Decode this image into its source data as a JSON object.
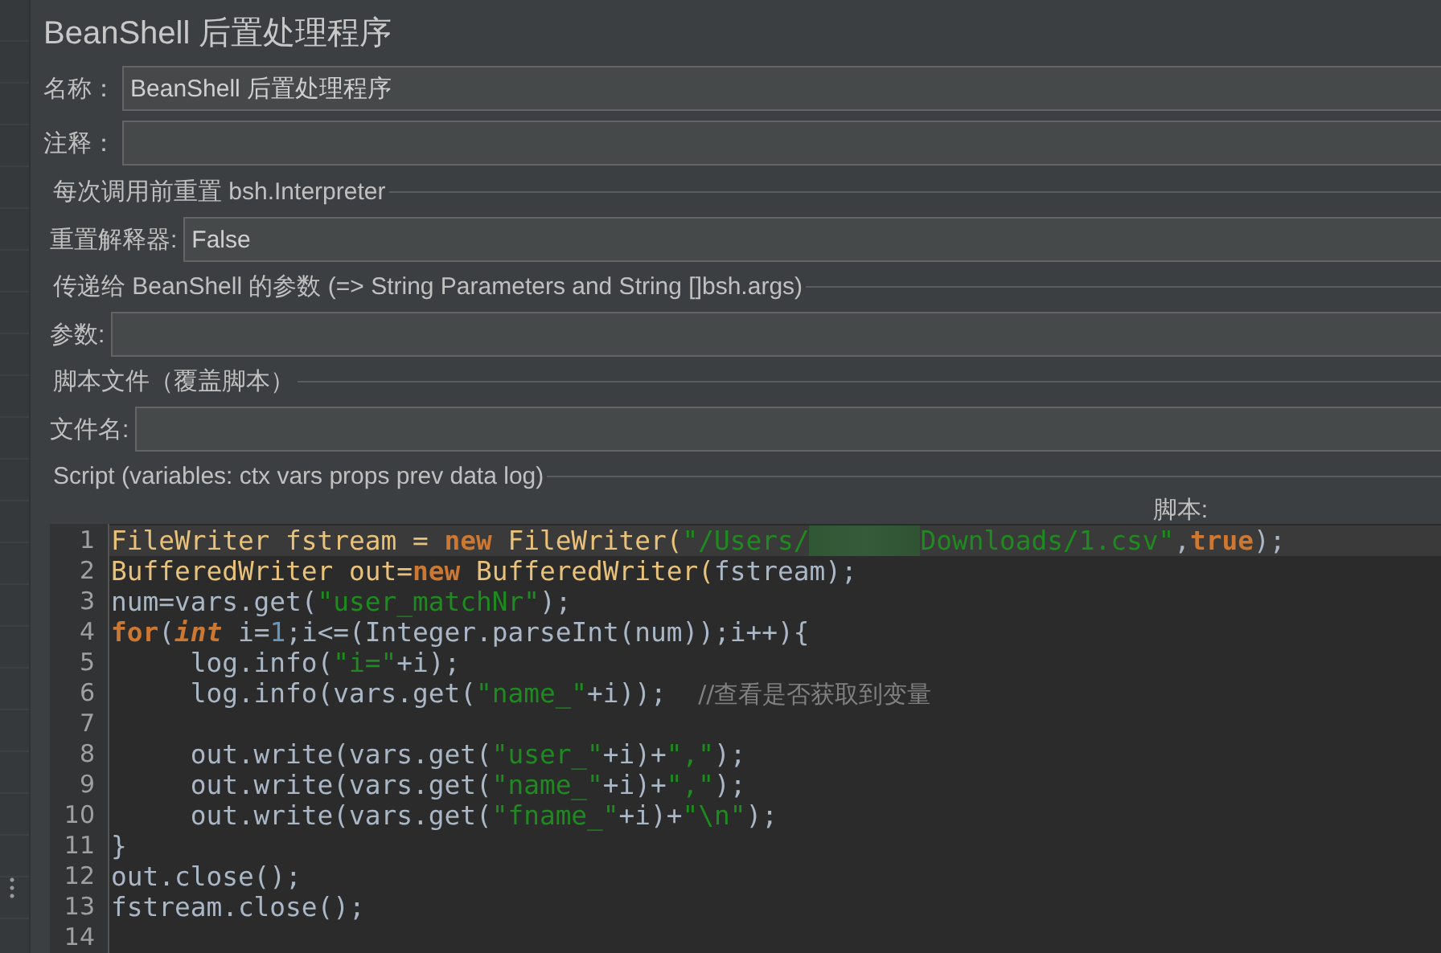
{
  "title": "BeanShell 后置处理程序",
  "fields": [
    {
      "label": "名称：",
      "value": "BeanShell 后置处理程序"
    },
    {
      "label": "注释："
    }
  ],
  "sections": [
    {
      "heading": "每次调用前重置 bsh.Interpreter",
      "field": {
        "label": "重置解释器:",
        "value": "False"
      }
    },
    {
      "heading": "传递给 BeanShell 的参数 (=> String Parameters and String []bsh.args)",
      "field": {
        "label": "参数:"
      }
    },
    {
      "heading": "脚本文件（覆盖脚本）",
      "field": {
        "label": "文件名:"
      }
    }
  ],
  "script": {
    "heading": "Script (variables: ctx vars props prev data log)",
    "editor_label": "脚本:",
    "lines": [
      {
        "number": "1",
        "current": true,
        "tokens": [
          {
            "kind": "class",
            "text": "FileWriter fstream = "
          },
          {
            "kind": "keyword",
            "text": "new"
          },
          {
            "kind": "class",
            "text": " FileWriter("
          },
          {
            "kind": "string",
            "text": "\"/Users/"
          },
          {
            "kind": "redacted"
          },
          {
            "kind": "string",
            "text": "Downloads/1.csv\""
          },
          {
            "kind": "plain",
            "text": ","
          },
          {
            "kind": "keyword",
            "text": "true"
          },
          {
            "kind": "plain",
            "text": ");"
          }
        ]
      },
      {
        "number": "2",
        "current": false,
        "tokens": [
          {
            "kind": "class",
            "text": "BufferedWriter out="
          },
          {
            "kind": "keyword",
            "text": "new"
          },
          {
            "kind": "class",
            "text": " BufferedWriter("
          },
          {
            "kind": "plain",
            "text": "fstream);"
          }
        ]
      },
      {
        "number": "3",
        "current": false,
        "tokens": [
          {
            "kind": "plain",
            "text": "num=vars.get("
          },
          {
            "kind": "string",
            "text": "\"user_matchNr\""
          },
          {
            "kind": "plain",
            "text": ");"
          }
        ]
      },
      {
        "number": "4",
        "current": false,
        "tokens": [
          {
            "kind": "keyword",
            "text": "for"
          },
          {
            "kind": "plain",
            "text": "("
          },
          {
            "kind": "type",
            "text": "int"
          },
          {
            "kind": "plain",
            "text": " i="
          },
          {
            "kind": "number",
            "text": "1"
          },
          {
            "kind": "plain",
            "text": ";i<=(Integer.parseInt(num));i++){"
          }
        ]
      },
      {
        "number": "5",
        "current": false,
        "tokens": [
          {
            "kind": "plain",
            "text": "     log.info("
          },
          {
            "kind": "string",
            "text": "\"i=\""
          },
          {
            "kind": "plain",
            "text": "+i);"
          }
        ]
      },
      {
        "number": "6",
        "current": false,
        "tokens": [
          {
            "kind": "plain",
            "text": "     log.info(vars.get("
          },
          {
            "kind": "string",
            "text": "\"name_\""
          },
          {
            "kind": "plain",
            "text": "+i));  "
          },
          {
            "kind": "comment",
            "text": "//查看是否获取到变量"
          }
        ]
      },
      {
        "number": "7",
        "current": false
      },
      {
        "number": "8",
        "current": false,
        "tokens": [
          {
            "kind": "plain",
            "text": "     out.write(vars.get("
          },
          {
            "kind": "string",
            "text": "\"user_\""
          },
          {
            "kind": "plain",
            "text": "+i)+"
          },
          {
            "kind": "string",
            "text": "\",\""
          },
          {
            "kind": "plain",
            "text": ");"
          }
        ]
      },
      {
        "number": "9",
        "current": false,
        "tokens": [
          {
            "kind": "plain",
            "text": "     out.write(vars.get("
          },
          {
            "kind": "string",
            "text": "\"name_\""
          },
          {
            "kind": "plain",
            "text": "+i)+"
          },
          {
            "kind": "string",
            "text": "\",\""
          },
          {
            "kind": "plain",
            "text": ");"
          }
        ]
      },
      {
        "number": "10",
        "current": false,
        "tokens": [
          {
            "kind": "plain",
            "text": "     out.write(vars.get("
          },
          {
            "kind": "string",
            "text": "\"fname_\""
          },
          {
            "kind": "plain",
            "text": "+i)+"
          },
          {
            "kind": "string",
            "text": "\"\\n\""
          },
          {
            "kind": "plain",
            "text": ");"
          }
        ]
      },
      {
        "number": "11",
        "current": false,
        "tokens": [
          {
            "kind": "plain",
            "text": "}"
          }
        ]
      },
      {
        "number": "12",
        "current": false,
        "tokens": [
          {
            "kind": "plain",
            "text": "out.close();"
          }
        ]
      },
      {
        "number": "13",
        "current": false,
        "tokens": [
          {
            "kind": "plain",
            "text": "fstream.close();"
          }
        ]
      },
      {
        "number": "14",
        "current": false
      }
    ]
  }
}
